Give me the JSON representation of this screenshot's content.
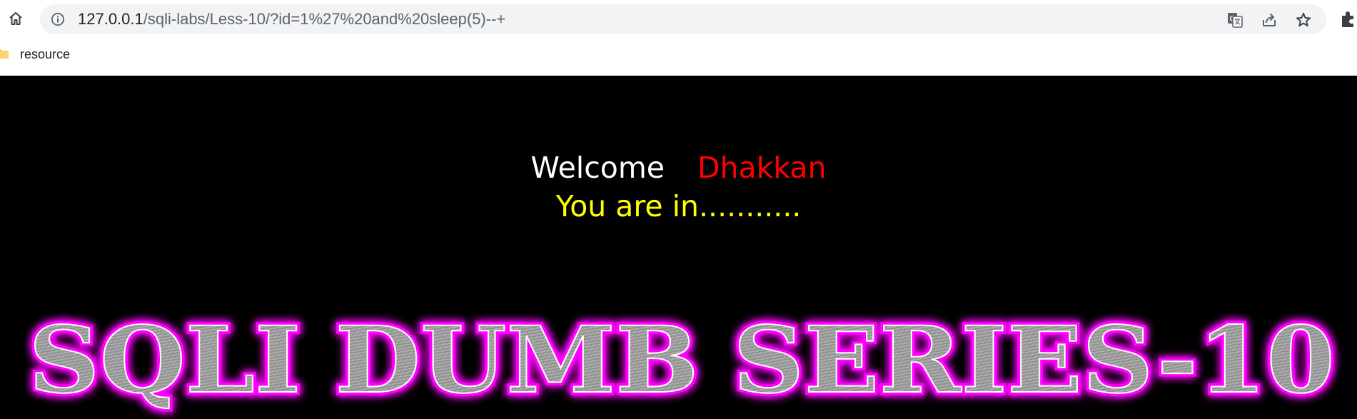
{
  "browser": {
    "url_host": "127.0.0.1",
    "url_path": "/sqli-labs/Less-10/?id=1%27%20and%20sleep(5)--+",
    "bookmarks": [
      {
        "label": "resource",
        "icon": "folder-icon"
      }
    ],
    "icons": [
      "home-icon",
      "info-icon",
      "translate-icon",
      "share-icon",
      "star-icon",
      "extensions-icon"
    ]
  },
  "page": {
    "welcome_text": "Welcome",
    "user_name": "Dhakkan",
    "status_text": "You are in...........",
    "banner_text": "SQLI DUMB SERIES-10",
    "colors": {
      "background": "#000000",
      "welcome": "#ffffff",
      "user_name": "#ff0000",
      "status": "#ffff00",
      "banner_glow": "#ff00ff",
      "banner_fill": "#9a9a9a"
    }
  }
}
